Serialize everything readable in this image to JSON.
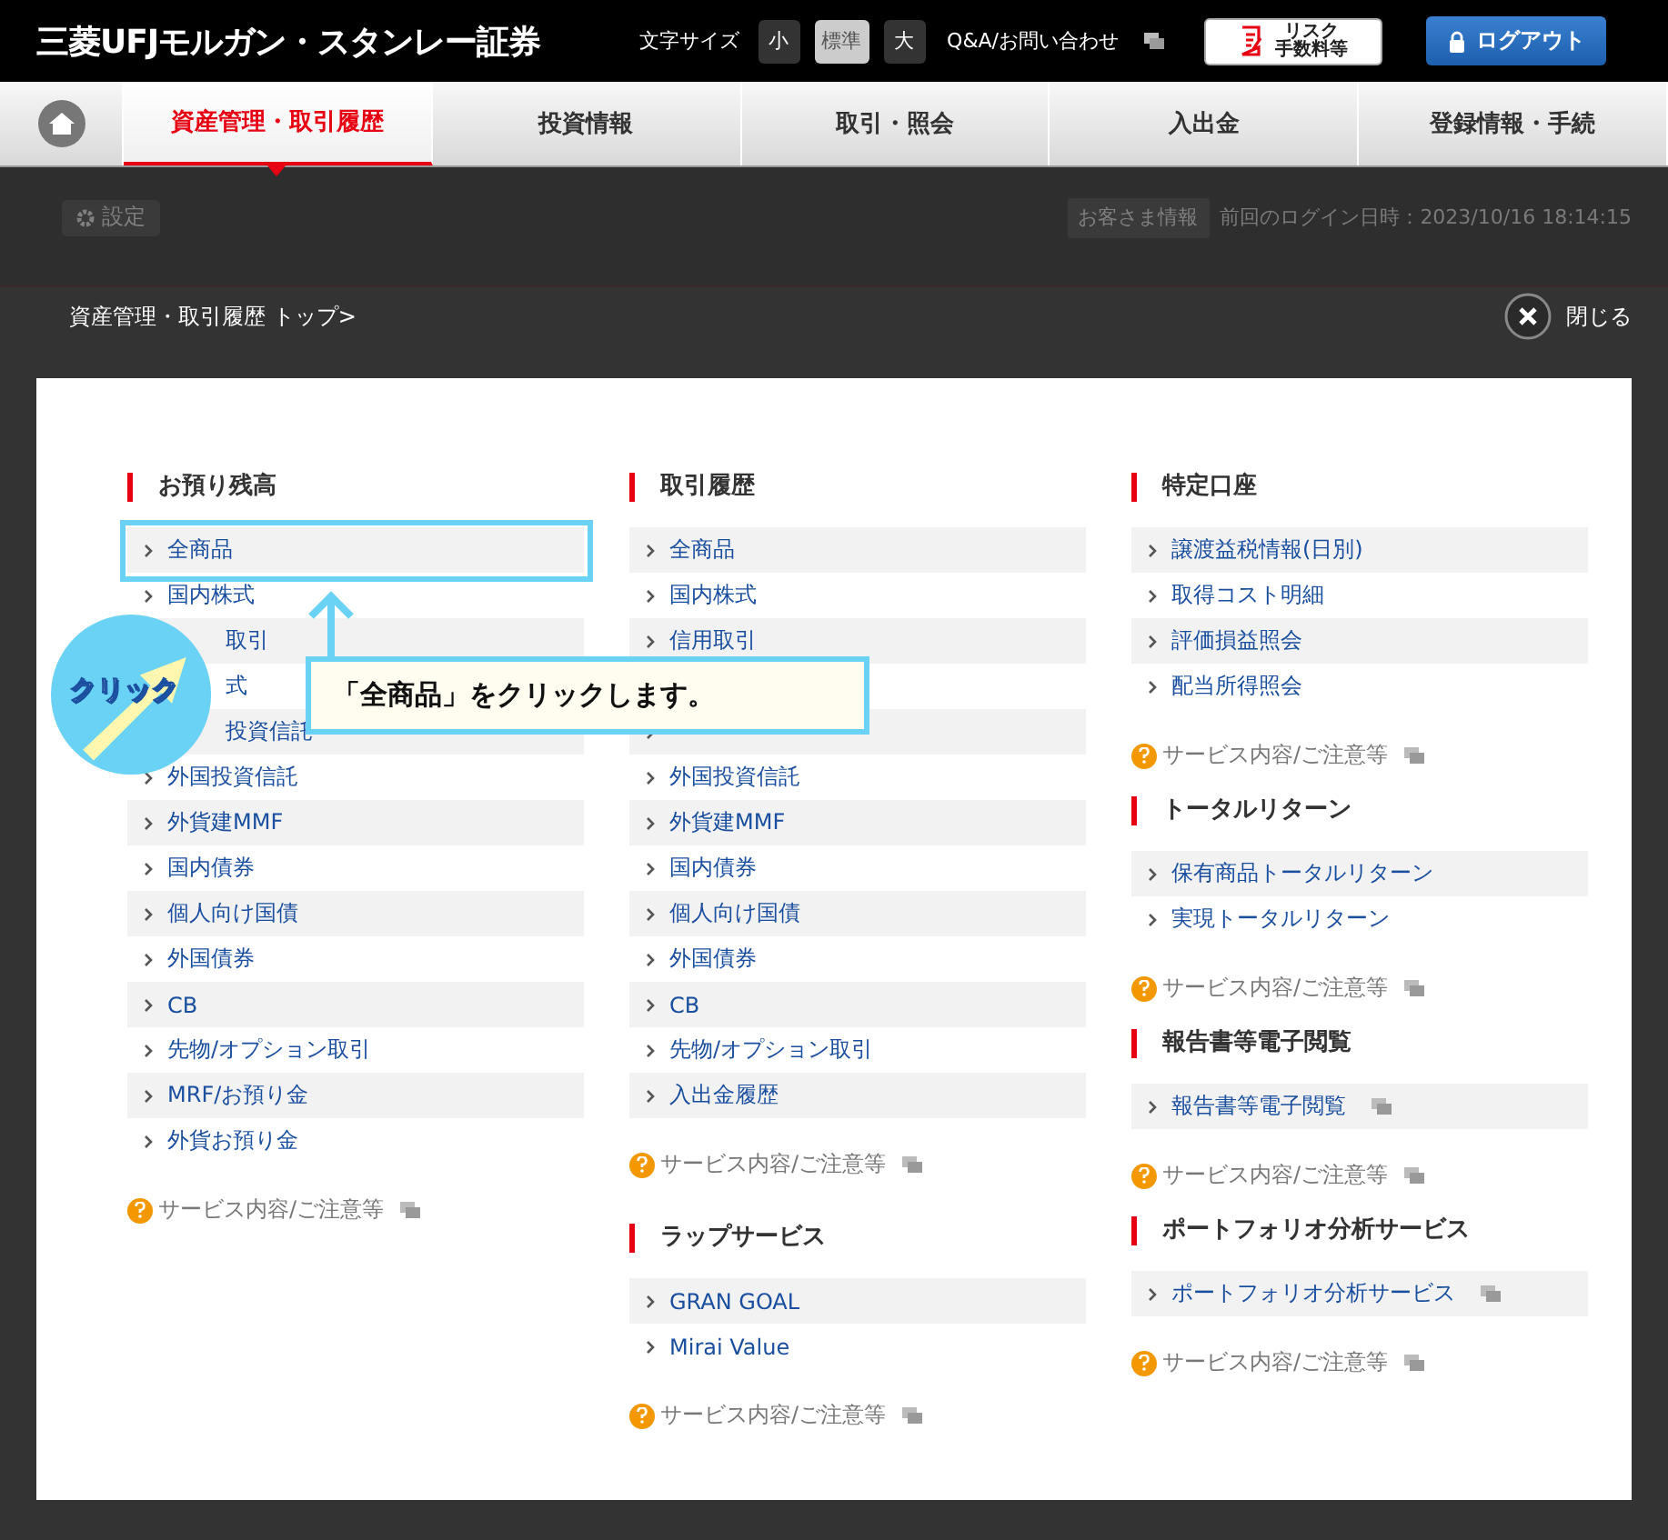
{
  "header": {
    "logo": "三菱UFJモルガン・スタンレー証券",
    "font_size_label": "文字サイズ",
    "font_sizes": [
      {
        "label": "小",
        "selected": false
      },
      {
        "label": "標準",
        "selected": true
      },
      {
        "label": "大",
        "selected": false
      }
    ],
    "contact_link": "Q&A/お問い合わせ",
    "risk_button": [
      "リスク",
      "手数料等"
    ],
    "logout_button": "ログアウト"
  },
  "nav": {
    "tabs": [
      {
        "label": "資産管理・取引履歴",
        "selected": true
      },
      {
        "label": "投資情報",
        "selected": false
      },
      {
        "label": "取引・照会",
        "selected": false
      },
      {
        "label": "入出金",
        "selected": false
      },
      {
        "label": "登録情報・手続",
        "selected": false
      }
    ]
  },
  "subbar": {
    "settings_button": "設定",
    "customer_button": "お客さま情報",
    "last_login": "前回のログイン日時：2023/10/16 18:14:15"
  },
  "breadcrumb": "資産管理・取引履歴 トップ>",
  "close_label": "閉じる",
  "columns": [
    [
      {
        "heading": "お預り残高",
        "items": [
          {
            "label": "全商品",
            "doc_icon": false
          },
          {
            "label": "国内株式",
            "doc_icon": false
          },
          {
            "label": "取引",
            "doc_icon": false,
            "covered": true
          },
          {
            "label": "式",
            "doc_icon": false,
            "covered": true
          },
          {
            "label": "投資信託",
            "doc_icon": false,
            "covered": true
          },
          {
            "label": "外国投資信託",
            "doc_icon": false
          },
          {
            "label": "外貨建MMF",
            "doc_icon": false
          },
          {
            "label": "国内債券",
            "doc_icon": false
          },
          {
            "label": "個人向け国債",
            "doc_icon": false
          },
          {
            "label": "外国債券",
            "doc_icon": false
          },
          {
            "label": "CB",
            "doc_icon": false
          },
          {
            "label": "先物/オプション取引",
            "doc_icon": false
          },
          {
            "label": "MRF/お預り金",
            "doc_icon": false
          },
          {
            "label": "外貨お預り金",
            "doc_icon": false
          }
        ],
        "note": "サービス内容/ご注意等"
      }
    ],
    [
      {
        "heading": "取引履歴",
        "items": [
          {
            "kind": "link",
            "label": "全商品",
            "doc_icon": false
          },
          {
            "kind": "link",
            "label": "国内株式",
            "doc_icon": false
          },
          {
            "kind": "link",
            "label": "信用取引",
            "doc_icon": false
          },
          {
            "kind": "blank"
          },
          {
            "kind": "link",
            "doc_icon": false
          },
          {
            "kind": "link",
            "label": "外国投資信託",
            "doc_icon": false
          },
          {
            "kind": "link",
            "label": "外貨建MMF",
            "doc_icon": false
          },
          {
            "kind": "link",
            "label": "国内債券",
            "doc_icon": false
          },
          {
            "kind": "link",
            "label": "個人向け国債",
            "doc_icon": false
          },
          {
            "kind": "link",
            "label": "外国債券",
            "doc_icon": false
          },
          {
            "kind": "link",
            "label": "CB",
            "doc_icon": false
          },
          {
            "kind": "link",
            "label": "先物/オプション取引",
            "doc_icon": false
          },
          {
            "kind": "link",
            "label": "入出金履歴",
            "doc_icon": false
          }
        ],
        "note": "サービス内容/ご注意等"
      },
      {
        "heading": "ラップサービス",
        "items": [
          {
            "label": "GRAN GOAL",
            "doc_icon": false
          },
          {
            "label": "Mirai Value",
            "doc_icon": false
          }
        ],
        "note": "サービス内容/ご注意等"
      }
    ],
    [
      {
        "heading": "特定口座",
        "items": [
          {
            "label": "譲渡益税情報(日別)",
            "doc_icon": false
          },
          {
            "label": "取得コスト明細",
            "doc_icon": false
          },
          {
            "label": "評価損益照会",
            "doc_icon": false
          },
          {
            "label": "配当所得照会",
            "doc_icon": false
          }
        ],
        "note": "サービス内容/ご注意等"
      },
      {
        "heading": "トータルリターン",
        "items": [
          {
            "label": "保有商品トータルリターン",
            "doc_icon": false
          },
          {
            "label": "実現トータルリターン",
            "doc_icon": false
          }
        ],
        "note": "サービス内容/ご注意等"
      },
      {
        "heading": "報告書等電子閲覧",
        "items": [
          {
            "label": "報告書等電子閲覧",
            "doc_icon": true
          }
        ],
        "note": "サービス内容/ご注意等"
      },
      {
        "heading": "ポートフォリオ分析サービス",
        "items": [
          {
            "label": "ポートフォリオ分析サービス",
            "doc_icon": true
          }
        ],
        "note": "サービス内容/ご注意等"
      }
    ]
  ],
  "annotation": {
    "badge": "クリック",
    "callout": "「全商品」をクリックします。"
  }
}
